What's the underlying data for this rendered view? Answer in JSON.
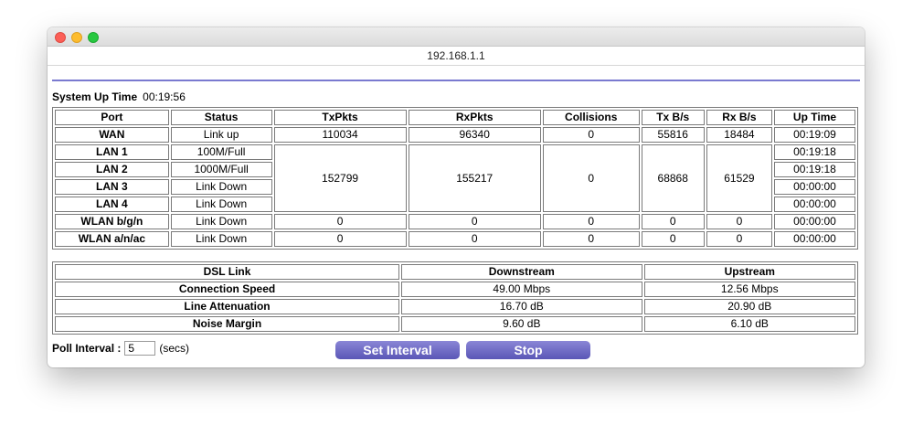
{
  "browser": {
    "url": "192.168.1.1"
  },
  "system": {
    "uptime_label": "System Up Time",
    "uptime_value": "00:19:56"
  },
  "stats_table": {
    "headers": [
      "Port",
      "Status",
      "TxPkts",
      "RxPkts",
      "Collisions",
      "Tx B/s",
      "Rx B/s",
      "Up Time"
    ],
    "wan": {
      "port": "WAN",
      "status": "Link up",
      "txpkts": "110034",
      "rxpkts": "96340",
      "collisions": "0",
      "txbs": "55816",
      "rxbs": "18484",
      "uptime": "00:19:09"
    },
    "lan_group": {
      "txpkts": "152799",
      "rxpkts": "155217",
      "collisions": "0",
      "txbs": "68868",
      "rxbs": "61529",
      "ports": [
        {
          "port": "LAN 1",
          "status": "100M/Full",
          "uptime": "00:19:18"
        },
        {
          "port": "LAN 2",
          "status": "1000M/Full",
          "uptime": "00:19:18"
        },
        {
          "port": "LAN 3",
          "status": "Link Down",
          "uptime": "00:00:00"
        },
        {
          "port": "LAN 4",
          "status": "Link Down",
          "uptime": "00:00:00"
        }
      ]
    },
    "wlan": [
      {
        "port": "WLAN b/g/n",
        "status": "Link Down",
        "txpkts": "0",
        "rxpkts": "0",
        "collisions": "0",
        "txbs": "0",
        "rxbs": "0",
        "uptime": "00:00:00"
      },
      {
        "port": "WLAN a/n/ac",
        "status": "Link Down",
        "txpkts": "0",
        "rxpkts": "0",
        "collisions": "0",
        "txbs": "0",
        "rxbs": "0",
        "uptime": "00:00:00"
      }
    ]
  },
  "dsl_table": {
    "headers": [
      "DSL Link",
      "Downstream",
      "Upstream"
    ],
    "rows": [
      {
        "label": "Connection Speed",
        "down": "49.00 Mbps",
        "up": "12.56 Mbps"
      },
      {
        "label": "Line Attenuation",
        "down": "16.70 dB",
        "up": "20.90 dB"
      },
      {
        "label": "Noise Margin",
        "down": "9.60 dB",
        "up": "6.10 dB"
      }
    ]
  },
  "poll": {
    "label": "Poll Interval :",
    "value": "5",
    "unit": "(secs)"
  },
  "buttons": {
    "set_interval": "Set Interval",
    "stop": "Stop"
  },
  "colors": {
    "accent_line": "#7a7ad0",
    "button_top": "#8a86d6",
    "button_bottom": "#5a56b6"
  }
}
